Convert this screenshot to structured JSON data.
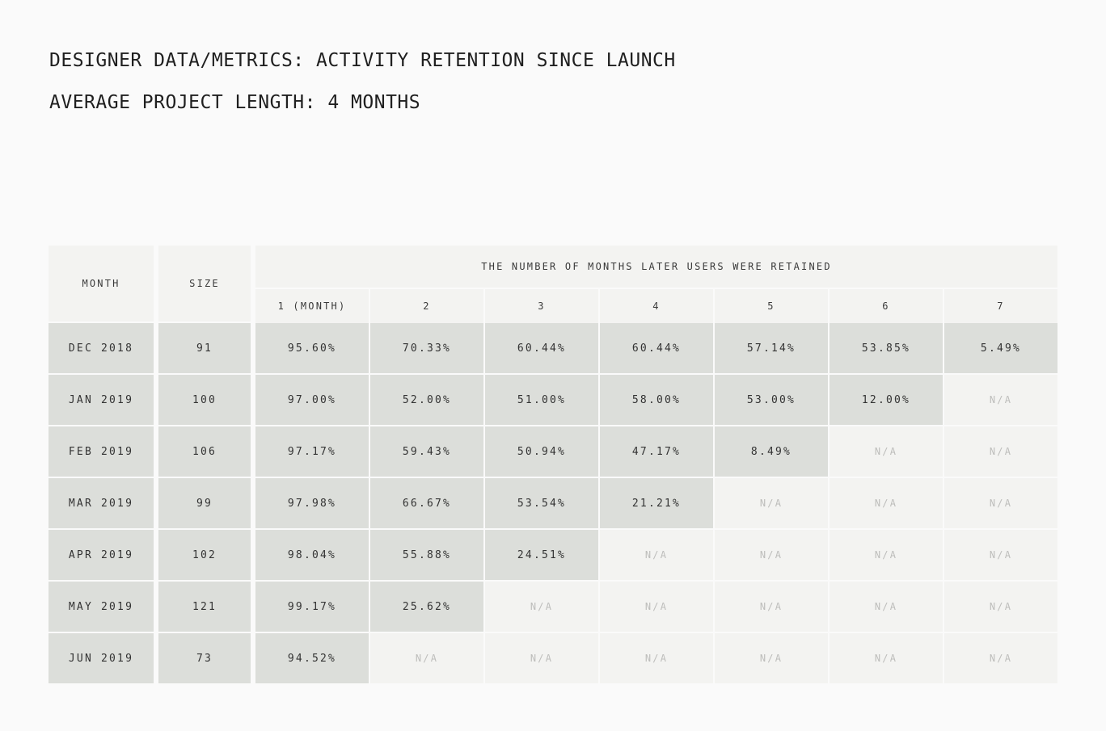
{
  "title": "DESIGNER DATA/METRICS: ACTIVITY RETENTION SINCE LAUNCH",
  "subtitle": "AVERAGE PROJECT LENGTH: 4 MONTHS",
  "chart_data": {
    "type": "table",
    "columns": {
      "month": "MONTH",
      "size": "SIZE",
      "group": "THE NUMBER OF MONTHS LATER USERS WERE RETAINED",
      "periods": [
        "1 (MONTH)",
        "2",
        "3",
        "4",
        "5",
        "6",
        "7"
      ]
    },
    "na_label": "N/A",
    "rows": [
      {
        "month": "DEC 2018",
        "size": "91",
        "values": [
          "95.60%",
          "70.33%",
          "60.44%",
          "60.44%",
          "57.14%",
          "53.85%",
          "5.49%"
        ]
      },
      {
        "month": "JAN 2019",
        "size": "100",
        "values": [
          "97.00%",
          "52.00%",
          "51.00%",
          "58.00%",
          "53.00%",
          "12.00%",
          "N/A"
        ]
      },
      {
        "month": "FEB 2019",
        "size": "106",
        "values": [
          "97.17%",
          "59.43%",
          "50.94%",
          "47.17%",
          "8.49%",
          "N/A",
          "N/A"
        ]
      },
      {
        "month": "MAR 2019",
        "size": "99",
        "values": [
          "97.98%",
          "66.67%",
          "53.54%",
          "21.21%",
          "N/A",
          "N/A",
          "N/A"
        ]
      },
      {
        "month": "APR 2019",
        "size": "102",
        "values": [
          "98.04%",
          "55.88%",
          "24.51%",
          "N/A",
          "N/A",
          "N/A",
          "N/A"
        ]
      },
      {
        "month": "MAY 2019",
        "size": "121",
        "values": [
          "99.17%",
          "25.62%",
          "N/A",
          "N/A",
          "N/A",
          "N/A",
          "N/A"
        ]
      },
      {
        "month": "JUN 2019",
        "size": "73",
        "values": [
          "94.52%",
          "N/A",
          "N/A",
          "N/A",
          "N/A",
          "N/A",
          "N/A"
        ]
      }
    ]
  }
}
